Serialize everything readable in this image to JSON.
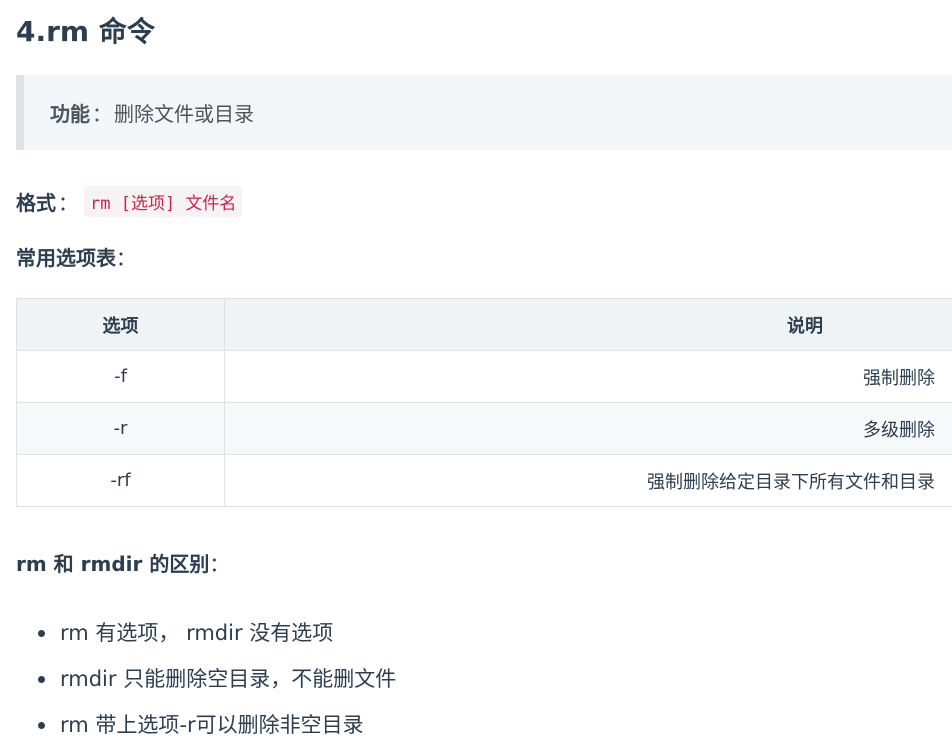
{
  "heading": "4.rm 命令",
  "function_block": {
    "label": "功能",
    "separator": "：",
    "text": "删除文件或目录"
  },
  "format": {
    "label": "格式",
    "separator": "：",
    "code": "rm [选项] 文件名"
  },
  "options_title": {
    "label": "常用选项表",
    "separator": "："
  },
  "table": {
    "headers": [
      "选项",
      "说明"
    ],
    "rows": [
      {
        "option": "-f",
        "description": "强制删除"
      },
      {
        "option": "-r",
        "description": "多级删除"
      },
      {
        "option": "-rf",
        "description": "强制删除给定目录下所有文件和目录"
      }
    ]
  },
  "difference": {
    "label": "rm 和 rmdir 的区别",
    "separator": "：",
    "items": [
      "rm 有选项， rmdir 没有选项",
      "rmdir 只能删除空目录，不能删文件",
      "rm 带上选项-r可以删除非空目录"
    ]
  }
}
